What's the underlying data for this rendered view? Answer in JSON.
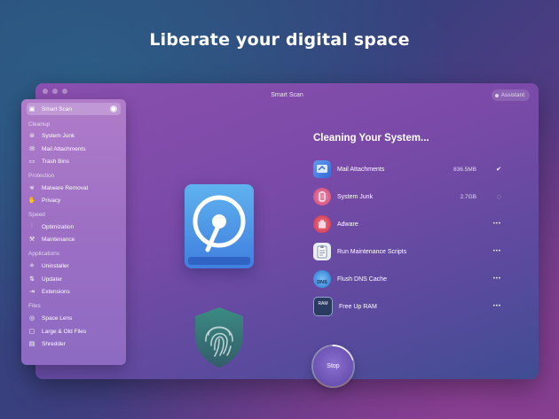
{
  "headline": "Liberate your digital space",
  "window": {
    "title": "Smart Scan",
    "assistant_label": "Assistant"
  },
  "sidebar": {
    "smart_scan": "Smart Scan",
    "sections": [
      {
        "header": "Cleanup",
        "items": [
          "System Junk",
          "Mail Attachments",
          "Trash Bins"
        ]
      },
      {
        "header": "Protection",
        "items": [
          "Malware Removal",
          "Privacy"
        ]
      },
      {
        "header": "Speed",
        "items": [
          "Optimization",
          "Maintenance"
        ]
      },
      {
        "header": "Applications",
        "items": [
          "Uninstaller",
          "Updater",
          "Extensions"
        ]
      },
      {
        "header": "Files",
        "items": [
          "Space Lens",
          "Large & Old Files",
          "Shredder"
        ]
      }
    ]
  },
  "main": {
    "title": "Cleaning Your System...",
    "tasks": [
      {
        "label": "Mail Attachments",
        "value": "836.5MB",
        "status": "✔"
      },
      {
        "label": "System Junk",
        "value": "2.7GB",
        "status": "◌"
      },
      {
        "label": "Adware",
        "value": "",
        "status": "•••"
      },
      {
        "label": "Run Maintenance Scripts",
        "value": "",
        "status": "•••"
      },
      {
        "label": "Flush DNS Cache",
        "value": "",
        "status": "•••"
      },
      {
        "label": "Free Up RAM",
        "value": "",
        "status": "•••"
      }
    ],
    "stop_label": "Stop",
    "dns_icon_text": "DNS",
    "ram_icon_text": "RAM"
  },
  "colors": {
    "accent": "#6a52b2",
    "sidebar": "#a273c6",
    "disk": "#4a8ee6",
    "shield": "#3f7a78"
  }
}
